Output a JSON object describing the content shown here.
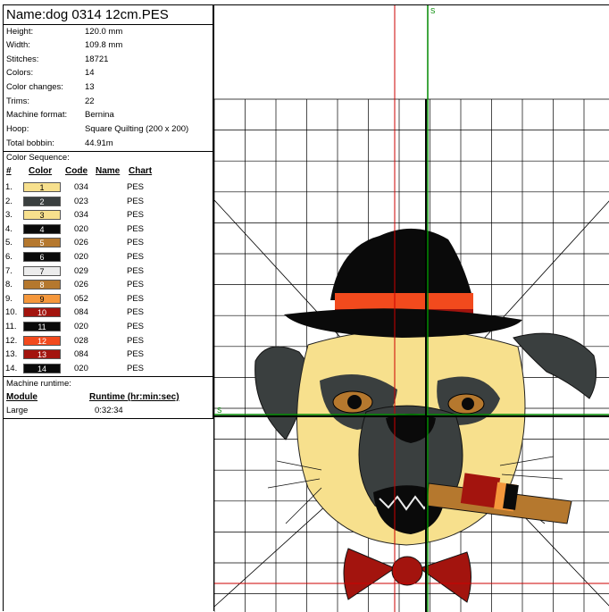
{
  "design": {
    "title": "Name:dog 0314 12cm.PES",
    "info": [
      {
        "label": "Height:",
        "value": "120.0 mm"
      },
      {
        "label": "Width:",
        "value": "109.8 mm"
      },
      {
        "label": "Stitches:",
        "value": "18721"
      },
      {
        "label": "Colors:",
        "value": "14"
      },
      {
        "label": "Color changes:",
        "value": "13"
      },
      {
        "label": "Trims:",
        "value": "22"
      },
      {
        "label": "Machine format:",
        "value": "Bernina"
      },
      {
        "label": "Hoop:",
        "value": "Square Quilting (200 x 200)"
      },
      {
        "label": "Total bobbin:",
        "value": "44.91m"
      }
    ]
  },
  "color_sequence": {
    "title": "Color Sequence:",
    "headers": {
      "num": "#",
      "color": "Color",
      "code": "Code",
      "name": "Name",
      "chart": "Chart"
    },
    "rows": [
      {
        "n": "1.",
        "sw": "1",
        "code": "034",
        "chart": "PES",
        "hex": "#f7e08d",
        "fg": "#000000"
      },
      {
        "n": "2.",
        "sw": "2",
        "code": "023",
        "chart": "PES",
        "hex": "#3a3f3f",
        "fg": "#ffffff"
      },
      {
        "n": "3.",
        "sw": "3",
        "code": "034",
        "chart": "PES",
        "hex": "#f7e08d",
        "fg": "#000000"
      },
      {
        "n": "4.",
        "sw": "4",
        "code": "020",
        "chart": "PES",
        "hex": "#0a0a0a",
        "fg": "#ffffff"
      },
      {
        "n": "5.",
        "sw": "5",
        "code": "026",
        "chart": "PES",
        "hex": "#b5782e",
        "fg": "#ffffff"
      },
      {
        "n": "6.",
        "sw": "6",
        "code": "020",
        "chart": "PES",
        "hex": "#0a0a0a",
        "fg": "#ffffff"
      },
      {
        "n": "7.",
        "sw": "7",
        "code": "029",
        "chart": "PES",
        "hex": "#ececec",
        "fg": "#000000"
      },
      {
        "n": "8.",
        "sw": "8",
        "code": "026",
        "chart": "PES",
        "hex": "#b5782e",
        "fg": "#ffffff"
      },
      {
        "n": "9.",
        "sw": "9",
        "code": "052",
        "chart": "PES",
        "hex": "#f5973b",
        "fg": "#000000"
      },
      {
        "n": "10.",
        "sw": "10",
        "code": "084",
        "chart": "PES",
        "hex": "#a3140e",
        "fg": "#ffffff"
      },
      {
        "n": "11.",
        "sw": "11",
        "code": "020",
        "chart": "PES",
        "hex": "#0a0a0a",
        "fg": "#ffffff"
      },
      {
        "n": "12.",
        "sw": "12",
        "code": "028",
        "chart": "PES",
        "hex": "#f24a1d",
        "fg": "#ffffff"
      },
      {
        "n": "13.",
        "sw": "13",
        "code": "084",
        "chart": "PES",
        "hex": "#a3140e",
        "fg": "#ffffff"
      },
      {
        "n": "14.",
        "sw": "14",
        "code": "020",
        "chart": "PES",
        "hex": "#0a0a0a",
        "fg": "#ffffff"
      }
    ]
  },
  "runtime": {
    "label": "Machine runtime:",
    "module_header": "Module",
    "runtime_header": "Runtime (hr:min:sec)",
    "module": "Large",
    "time": "0:32:34"
  },
  "canvas": {
    "guide_label_top": "S",
    "guide_label_left": "S",
    "colors": {
      "grid": "#000000",
      "guide_red": "#cc0000",
      "guide_green": "#008a00"
    }
  }
}
